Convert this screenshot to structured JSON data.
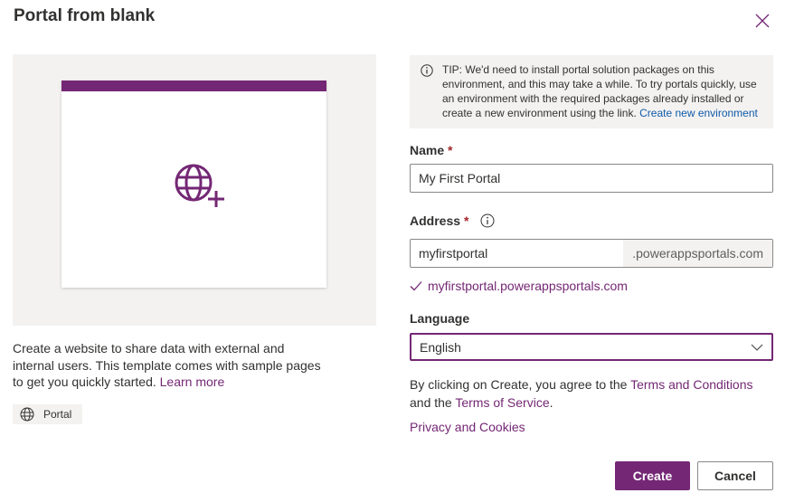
{
  "dialog": {
    "title": "Portal from blank",
    "close_icon": "close-icon"
  },
  "preview": {
    "accent_color": "#742774",
    "icon": "globe-add-icon"
  },
  "description": {
    "text": "Create a website to share data with external and internal users. This template comes with sample pages to get you quickly started. ",
    "learn_more": "Learn more"
  },
  "tag": {
    "icon": "globe-icon",
    "label": "Portal"
  },
  "tip": {
    "icon": "info-icon",
    "text": "TIP: We'd need to install portal solution packages on this environment, and this may take a while. To try portals quickly, use an environment with the required packages already installed or create a new environment using the link. ",
    "link": "Create new environment"
  },
  "form": {
    "name_label": "Name",
    "name_value": "My First Portal",
    "address_label": "Address",
    "address_value": "myfirstportal",
    "address_suffix": ".powerappsportals.com",
    "address_check": "myfirstportal.powerappsportals.com",
    "language_label": "Language",
    "language_value": "English",
    "required_mark": "*"
  },
  "legal": {
    "prefix": "By clicking on Create, you agree to the ",
    "terms_conditions": "Terms and Conditions",
    "middle": " and the ",
    "terms_service": "Terms of Service",
    "suffix": ".",
    "privacy": "Privacy and Cookies"
  },
  "actions": {
    "create": "Create",
    "cancel": "Cancel"
  }
}
